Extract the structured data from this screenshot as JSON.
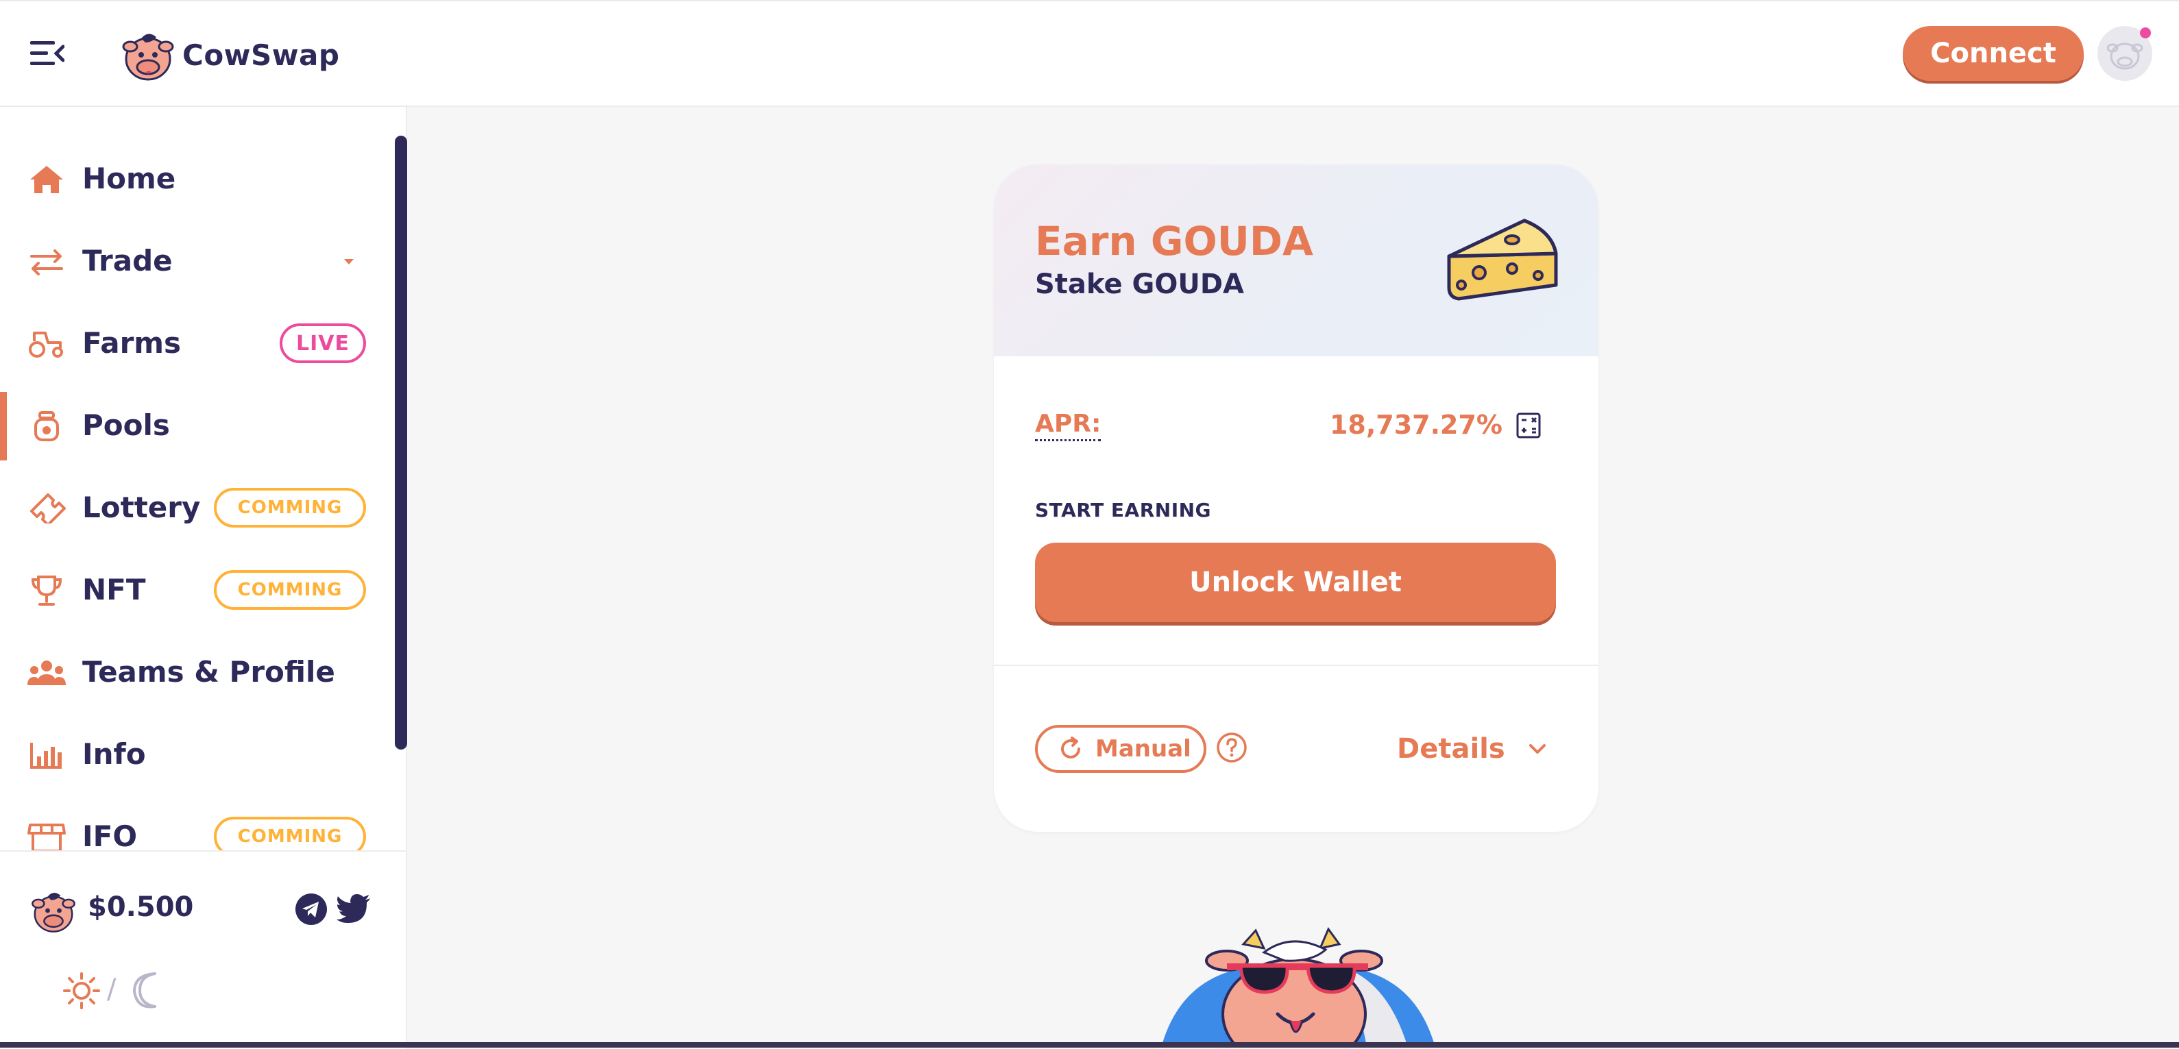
{
  "header": {
    "brand": "CowSwap",
    "connect_label": "Connect"
  },
  "sidebar": {
    "items": [
      {
        "label": "Home",
        "icon": "home-icon"
      },
      {
        "label": "Trade",
        "icon": "swap-arrows-icon"
      },
      {
        "label": "Farms",
        "icon": "tractor-icon",
        "badge": "LIVE"
      },
      {
        "label": "Pools",
        "icon": "honeypot-icon",
        "active": true
      },
      {
        "label": "Lottery",
        "icon": "ticket-icon",
        "badge": "COMMING"
      },
      {
        "label": "NFT",
        "icon": "trophy-icon",
        "badge": "COMMING"
      },
      {
        "label": "Teams & Profile",
        "icon": "group-icon"
      },
      {
        "label": "Info",
        "icon": "chart-icon"
      },
      {
        "label": "IFO",
        "icon": "shop-icon",
        "badge": "COMMING"
      }
    ],
    "footer": {
      "price": "$0.500",
      "theme_separator": "/"
    }
  },
  "pool_card": {
    "title": "Earn GOUDA",
    "subtitle": "Stake GOUDA",
    "apr_label": "APR:",
    "apr_value": "18,737.27%",
    "start_label": "START EARNING",
    "unlock_label": "Unlock Wallet",
    "manual_label": "Manual",
    "details_label": "Details"
  },
  "colors": {
    "accent": "#e57a55",
    "navy": "#2d2a5a",
    "live": "#ed4b9e",
    "soon": "#ffb237"
  }
}
